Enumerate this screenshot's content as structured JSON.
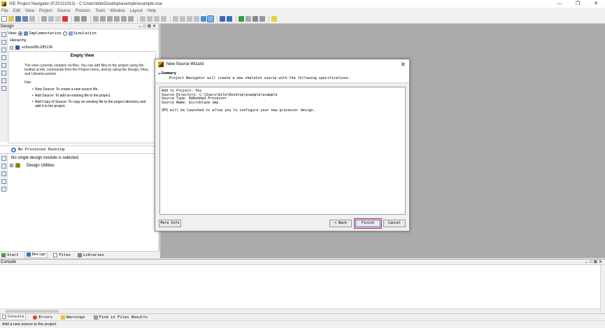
{
  "window": {
    "title": "ISE Project Navigator (P.20131013) - C:\\Users\\bite\\Desktop\\example\\example.xise",
    "controls": [
      "—",
      "❐",
      "✕"
    ]
  },
  "menu": [
    "File",
    "Edit",
    "View",
    "Project",
    "Source",
    "Process",
    "Tools",
    "Window",
    "Layout",
    "Help"
  ],
  "design_panel": {
    "header": "Design",
    "view_label": "View:",
    "view_options": [
      "Implementation",
      "Simulation"
    ],
    "selected_view": "Implementation",
    "hierarchy_label": "Hierarchy",
    "device": "xc5vsx95t-2ff1136",
    "empty_view": {
      "title": "Empty View",
      "text": "The view currently contains no files. You can add files to the project using the toolbar at left, commands from the Project menu, and by using the Design, Files, and Libraries panels.",
      "use_label": "Use:",
      "bullets": [
        "New Source: To create a new source file.",
        "Add Source: To add an existing file to the project.",
        "Add Copy of Source: To copy an existing file to the project directory and add it to the project."
      ]
    },
    "processes_header": "No Processes Running",
    "processes_message": "No single design module is selected.",
    "design_utilities": "Design Utilities"
  },
  "left_tabs": [
    "Start",
    "Design",
    "Files",
    "Libraries"
  ],
  "dialog": {
    "title": "New Source Wizard",
    "close": "✕",
    "heading": "Summary",
    "subheading": "Project Navigator will create a new skeleton source with the following specifications.",
    "summary_lines": [
      "Add to Project: Yes",
      "Source Directory: C:\\Users\\bite\\Desktop\\example\\example",
      "Source Type: Embedded Processor",
      "Source Name: microblaze smp"
    ],
    "note": "XPS will be launched to allow you to configure your new processor design.",
    "buttons": {
      "more_info": "More Info",
      "back": "< Back",
      "finish": "Finish",
      "cancel": "Cancel"
    }
  },
  "console": {
    "header": "Console"
  },
  "bottom_tabs": [
    "Console",
    "Errors",
    "Warnings",
    "Find in Files Results"
  ],
  "status_text": "Add a new source to the project",
  "colors": {
    "workspace": "#ababab",
    "finish_highlight": "#d0202a",
    "accent": "#3b7bd0"
  }
}
